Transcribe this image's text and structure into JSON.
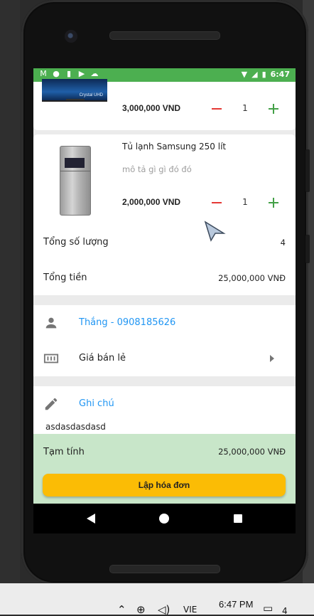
{
  "status_bar": {
    "time": "6:47"
  },
  "products": [
    {
      "price": "3,000,000 VND",
      "quantity": "1",
      "image_label": "Crystal UHD"
    },
    {
      "name": "Tủ lạnh Samsung 250 lít",
      "description": "mô tả gì gì đó đó",
      "price": "2,000,000 VND",
      "quantity": "1"
    }
  ],
  "summary": {
    "total_qty_label": "Tổng số lượng",
    "total_qty_value": "4",
    "total_amount_label": "Tổng tiền",
    "total_amount_value": "25,000,000 VNĐ"
  },
  "customer": {
    "name": "Thắng - 0908185626"
  },
  "price_list": {
    "label": "Giá bán lẻ"
  },
  "note": {
    "label": "Ghi chú",
    "text": "asdasdasdasd"
  },
  "footer": {
    "subtotal_label": "Tạm tính",
    "subtotal_value": "25,000,000 VNĐ",
    "invoice_button": "Lập hóa đơn"
  },
  "taskbar": {
    "language": "VIE",
    "time": "6:47 PM",
    "badge": "4"
  },
  "colors": {
    "status_bar": "#4caf50",
    "accent_blue": "#2196f3",
    "minus_red": "#e53935",
    "plus_green": "#43a047",
    "button_yellow": "#fbbc05",
    "footer_green": "#c8e6c9"
  }
}
